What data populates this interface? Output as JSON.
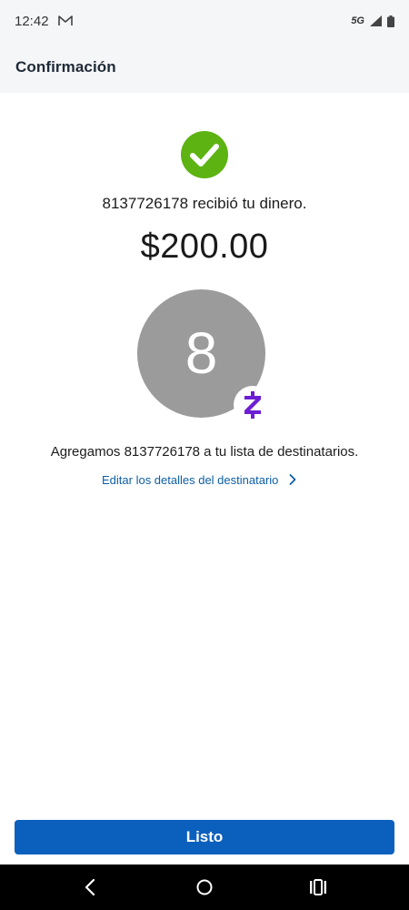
{
  "status_bar": {
    "time": "12:42",
    "network": "5G",
    "notification_icon": "gmail-icon"
  },
  "header": {
    "title": "Confirmación"
  },
  "confirmation": {
    "icon": "check-circle-icon",
    "received_message": "8137726178 recibió tu dinero.",
    "amount": "$200.00",
    "avatar_initial": "8",
    "badge_icon": "zelle-icon",
    "added_message": "Agregamos 8137726178 a tu lista de destinatarios.",
    "edit_link_label": "Editar los detalles del destinatario"
  },
  "actions": {
    "done_label": "Listo"
  },
  "colors": {
    "success": "#5db312",
    "primary": "#0b60bd",
    "link": "#0d5fa5",
    "zelle": "#6d1ed4",
    "avatar": "#9b9b9b"
  },
  "nav_bar": {
    "items": [
      "back-icon",
      "home-icon",
      "recents-icon"
    ]
  }
}
